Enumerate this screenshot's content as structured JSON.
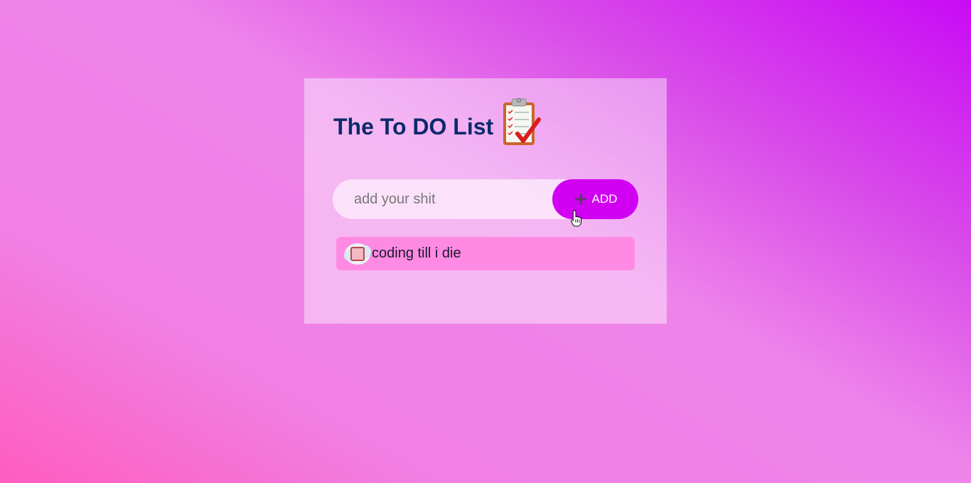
{
  "header": {
    "title": "The To DO List",
    "title_icon": "clipboard-checklist-icon"
  },
  "input": {
    "placeholder": "add your shit",
    "value": ""
  },
  "add_button": {
    "label": "ADD",
    "icon": "plus-icon"
  },
  "todos": [
    {
      "text": "coding till i die",
      "completed": false
    }
  ],
  "colors": {
    "title": "#0b2a6b",
    "add_button": "#d100f2",
    "todo_item": "#ff8ae4"
  }
}
